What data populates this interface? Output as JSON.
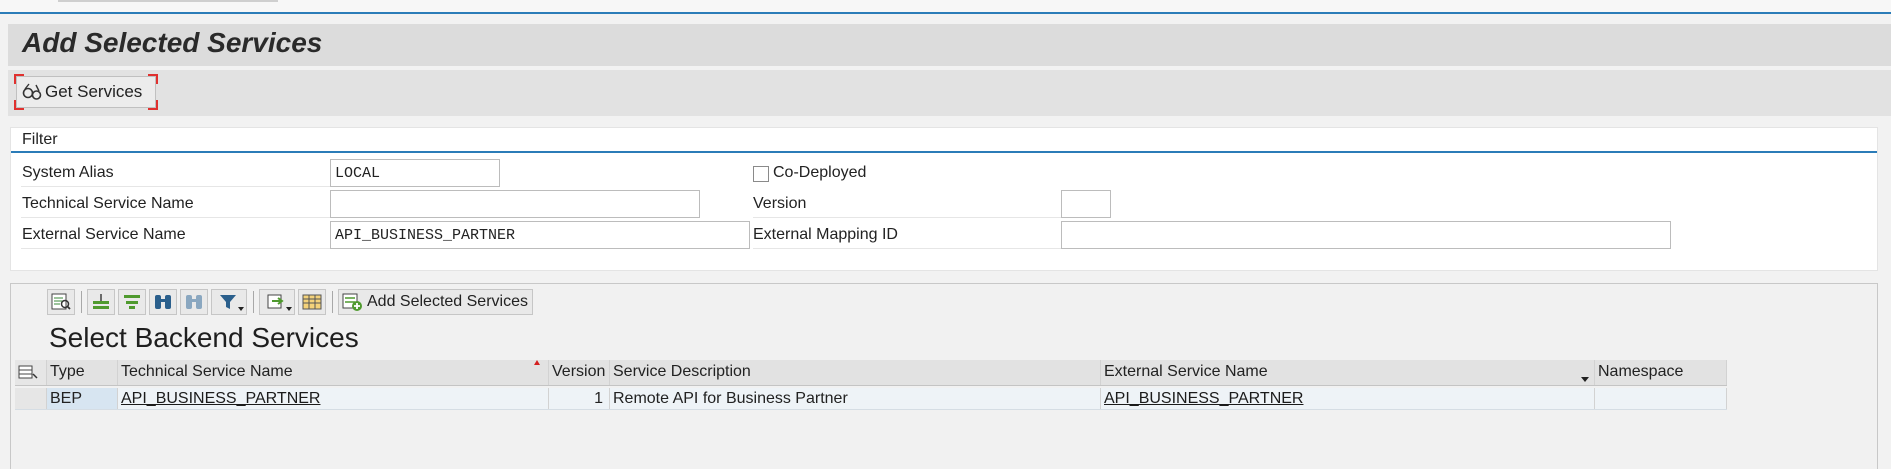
{
  "page": {
    "title": "Add Selected Services"
  },
  "toolbar": {
    "get_services_label": "Get Services",
    "get_services_icon": "glasses-icon"
  },
  "filter": {
    "heading": "Filter",
    "system_alias_label": "System Alias",
    "system_alias_value": "LOCAL",
    "technical_service_name_label": "Technical Service Name",
    "technical_service_name_value": "",
    "external_service_name_label": "External Service Name",
    "external_service_name_value": "API_BUSINESS_PARTNER",
    "co_deployed_label": "Co-Deployed",
    "co_deployed_checked": false,
    "version_label": "Version",
    "version_value": "",
    "external_mapping_id_label": "External Mapping ID",
    "external_mapping_id_value": ""
  },
  "alv": {
    "toolbar_icons": [
      "details-icon",
      "sort-ascending-icon",
      "sort-descending-icon",
      "find-icon",
      "find-next-icon",
      "filter-icon",
      "export-icon",
      "layout-grid-icon",
      "add-service-icon"
    ],
    "add_selected_label": "Add Selected Services",
    "title": "Select Backend Services",
    "columns": {
      "type": "Type",
      "technical_service_name": "Technical Service Name",
      "version": "Version",
      "service_description": "Service Description",
      "external_service_name": "External Service Name",
      "namespace": "Namespace"
    },
    "rows": [
      {
        "type": "BEP",
        "technical_service_name": "API_BUSINESS_PARTNER",
        "version": "1",
        "service_description": "Remote API for Business Partner",
        "external_service_name": "API_BUSINESS_PARTNER",
        "namespace": ""
      }
    ]
  },
  "colors": {
    "accent_blue": "#2b7cb8",
    "title_bar": "#dcdcdc",
    "focus_red": "#e0312f"
  }
}
